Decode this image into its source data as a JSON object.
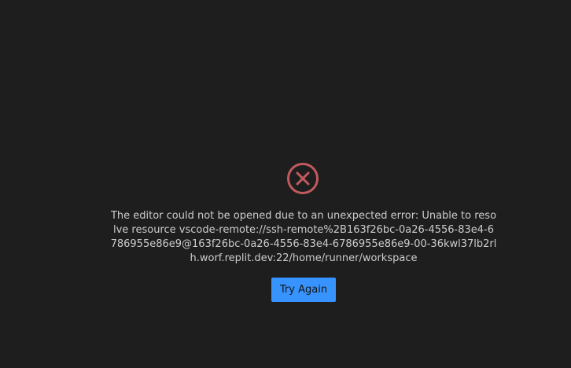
{
  "error": {
    "icon": "error-circle-x-icon",
    "icon_color": "#c05a5e",
    "message": "The editor could not be opened due to an unexpected error: Unable to resolve resource vscode-remote://ssh-remote%2B163f26bc-0a26-4556-83e4-6786955e86e9@163f26bc-0a26-4556-83e4-6786955e86e9-00-36kwl37lb2rlh.worf.replit.dev:22/home/runner/workspace"
  },
  "actions": {
    "try_again_label": "Try Again",
    "button_color": "#3794ff"
  },
  "theme": {
    "background": "#1e1e1e",
    "text_color": "#cccccc"
  }
}
